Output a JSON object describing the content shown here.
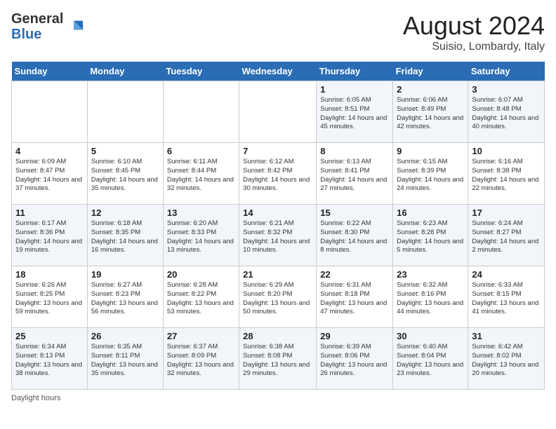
{
  "header": {
    "logo_general": "General",
    "logo_blue": "Blue",
    "title": "August 2024",
    "subtitle": "Suisio, Lombardy, Italy"
  },
  "days_of_week": [
    "Sunday",
    "Monday",
    "Tuesday",
    "Wednesday",
    "Thursday",
    "Friday",
    "Saturday"
  ],
  "weeks": [
    [
      {
        "day": "",
        "detail": ""
      },
      {
        "day": "",
        "detail": ""
      },
      {
        "day": "",
        "detail": ""
      },
      {
        "day": "",
        "detail": ""
      },
      {
        "day": "1",
        "detail": "Sunrise: 6:05 AM\nSunset: 8:51 PM\nDaylight: 14 hours and 45 minutes."
      },
      {
        "day": "2",
        "detail": "Sunrise: 6:06 AM\nSunset: 8:49 PM\nDaylight: 14 hours and 42 minutes."
      },
      {
        "day": "3",
        "detail": "Sunrise: 6:07 AM\nSunset: 8:48 PM\nDaylight: 14 hours and 40 minutes."
      }
    ],
    [
      {
        "day": "4",
        "detail": "Sunrise: 6:09 AM\nSunset: 8:47 PM\nDaylight: 14 hours and 37 minutes."
      },
      {
        "day": "5",
        "detail": "Sunrise: 6:10 AM\nSunset: 8:45 PM\nDaylight: 14 hours and 35 minutes."
      },
      {
        "day": "6",
        "detail": "Sunrise: 6:11 AM\nSunset: 8:44 PM\nDaylight: 14 hours and 32 minutes."
      },
      {
        "day": "7",
        "detail": "Sunrise: 6:12 AM\nSunset: 8:42 PM\nDaylight: 14 hours and 30 minutes."
      },
      {
        "day": "8",
        "detail": "Sunrise: 6:13 AM\nSunset: 8:41 PM\nDaylight: 14 hours and 27 minutes."
      },
      {
        "day": "9",
        "detail": "Sunrise: 6:15 AM\nSunset: 8:39 PM\nDaylight: 14 hours and 24 minutes."
      },
      {
        "day": "10",
        "detail": "Sunrise: 6:16 AM\nSunset: 8:38 PM\nDaylight: 14 hours and 22 minutes."
      }
    ],
    [
      {
        "day": "11",
        "detail": "Sunrise: 6:17 AM\nSunset: 8:36 PM\nDaylight: 14 hours and 19 minutes."
      },
      {
        "day": "12",
        "detail": "Sunrise: 6:18 AM\nSunset: 8:35 PM\nDaylight: 14 hours and 16 minutes."
      },
      {
        "day": "13",
        "detail": "Sunrise: 6:20 AM\nSunset: 8:33 PM\nDaylight: 14 hours and 13 minutes."
      },
      {
        "day": "14",
        "detail": "Sunrise: 6:21 AM\nSunset: 8:32 PM\nDaylight: 14 hours and 10 minutes."
      },
      {
        "day": "15",
        "detail": "Sunrise: 6:22 AM\nSunset: 8:30 PM\nDaylight: 14 hours and 8 minutes."
      },
      {
        "day": "16",
        "detail": "Sunrise: 6:23 AM\nSunset: 8:28 PM\nDaylight: 14 hours and 5 minutes."
      },
      {
        "day": "17",
        "detail": "Sunrise: 6:24 AM\nSunset: 8:27 PM\nDaylight: 14 hours and 2 minutes."
      }
    ],
    [
      {
        "day": "18",
        "detail": "Sunrise: 6:26 AM\nSunset: 8:25 PM\nDaylight: 13 hours and 59 minutes."
      },
      {
        "day": "19",
        "detail": "Sunrise: 6:27 AM\nSunset: 8:23 PM\nDaylight: 13 hours and 56 minutes."
      },
      {
        "day": "20",
        "detail": "Sunrise: 6:28 AM\nSunset: 8:22 PM\nDaylight: 13 hours and 53 minutes."
      },
      {
        "day": "21",
        "detail": "Sunrise: 6:29 AM\nSunset: 8:20 PM\nDaylight: 13 hours and 50 minutes."
      },
      {
        "day": "22",
        "detail": "Sunrise: 6:31 AM\nSunset: 8:18 PM\nDaylight: 13 hours and 47 minutes."
      },
      {
        "day": "23",
        "detail": "Sunrise: 6:32 AM\nSunset: 8:16 PM\nDaylight: 13 hours and 44 minutes."
      },
      {
        "day": "24",
        "detail": "Sunrise: 6:33 AM\nSunset: 8:15 PM\nDaylight: 13 hours and 41 minutes."
      }
    ],
    [
      {
        "day": "25",
        "detail": "Sunrise: 6:34 AM\nSunset: 8:13 PM\nDaylight: 13 hours and 38 minutes."
      },
      {
        "day": "26",
        "detail": "Sunrise: 6:35 AM\nSunset: 8:11 PM\nDaylight: 13 hours and 35 minutes."
      },
      {
        "day": "27",
        "detail": "Sunrise: 6:37 AM\nSunset: 8:09 PM\nDaylight: 13 hours and 32 minutes."
      },
      {
        "day": "28",
        "detail": "Sunrise: 6:38 AM\nSunset: 8:08 PM\nDaylight: 13 hours and 29 minutes."
      },
      {
        "day": "29",
        "detail": "Sunrise: 6:39 AM\nSunset: 8:06 PM\nDaylight: 13 hours and 26 minutes."
      },
      {
        "day": "30",
        "detail": "Sunrise: 6:40 AM\nSunset: 8:04 PM\nDaylight: 13 hours and 23 minutes."
      },
      {
        "day": "31",
        "detail": "Sunrise: 6:42 AM\nSunset: 8:02 PM\nDaylight: 13 hours and 20 minutes."
      }
    ]
  ],
  "footer": {
    "note": "Daylight hours"
  }
}
